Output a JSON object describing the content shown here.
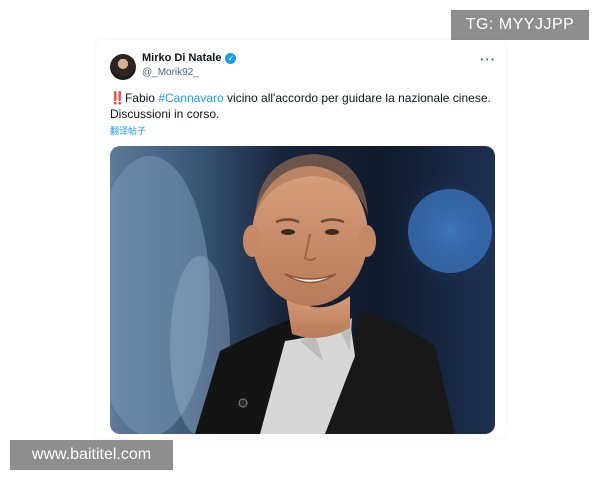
{
  "watermark_tg": "TG: MYYJJPP",
  "watermark_site": "www.baititel.com",
  "tweet": {
    "author_name": "Mirko Di Natale",
    "author_handle": "@_Morik92_",
    "verified": true,
    "more_label": "···",
    "alert_emoji": "‼️",
    "text_before": "Fabio ",
    "hashtag": "#Cannavaro",
    "text_after": " vicino all'accordo per guidare la nazionale cinese. Discussioni in corso.",
    "translate_label": "翻译帖子"
  },
  "icons": {
    "verified": "verified-badge-icon",
    "more": "more-options-icon",
    "alert": "double-exclamation-icon"
  },
  "colors": {
    "link": "#1d9bf0",
    "text": "#0f1419",
    "secondary": "#536471",
    "watermark_bg": "#8e8e8e"
  }
}
